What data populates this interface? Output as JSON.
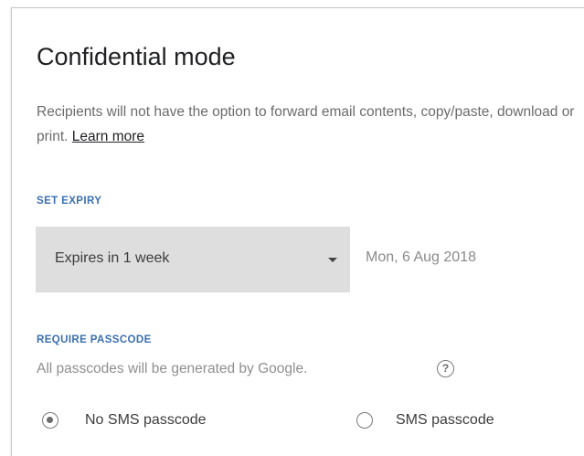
{
  "dialog": {
    "title": "Confidential mode",
    "description": "Recipients will not have the option to forward email contents, copy/paste, download or print.",
    "learn_more": "Learn more"
  },
  "expiry": {
    "label": "SET EXPIRY",
    "selected": "Expires in 1 week",
    "date": "Mon, 6 Aug 2018"
  },
  "passcode": {
    "label": "REQUIRE PASSCODE",
    "hint": "All passcodes will be generated by Google.",
    "help_icon": "?",
    "options": [
      {
        "label": "No SMS passcode",
        "checked": true
      },
      {
        "label": "SMS passcode",
        "checked": false
      }
    ]
  },
  "colors": {
    "accent": "#3a6fb0",
    "select_bg": "#dedede"
  }
}
